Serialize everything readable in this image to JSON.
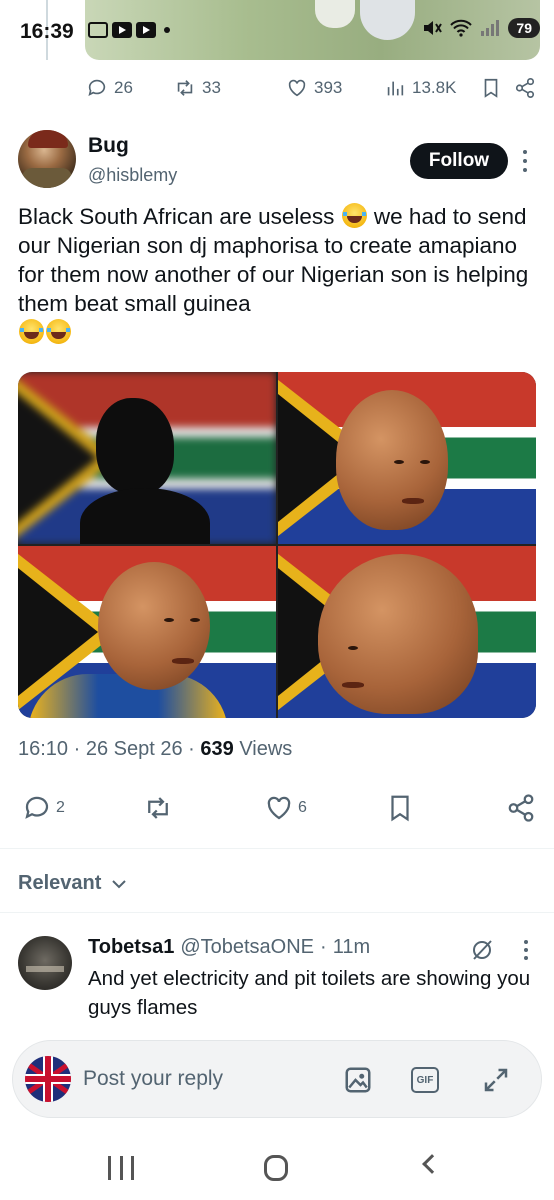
{
  "status_bar": {
    "time": "16:39",
    "battery": "79",
    "icons": [
      "screenshot-icon",
      "youtube-icon",
      "youtube-icon",
      "notification-dot",
      "mute-icon",
      "wifi-icon",
      "signal-icon",
      "battery-icon"
    ]
  },
  "top_actions": {
    "replies": "26",
    "reposts": "33",
    "likes": "393",
    "views": "13.8K"
  },
  "tweet": {
    "author_name": "Bug",
    "author_handle": "@hisblemy",
    "follow_label": "Follow",
    "text_part1": "Black South African are useless ",
    "text_part2": " we had to send our Nigerian son dj maphorisa to create amapiano for them now another of our Nigerian son is helping them beat small guinea ",
    "time": "16:10",
    "date": "26 Sept 26",
    "views_count": "639",
    "views_label": "Views",
    "media_description_icons": [
      "silhouette",
      "face-1",
      "face-2",
      "face-3"
    ]
  },
  "actions": {
    "replies": "2",
    "reposts": "",
    "likes": "6"
  },
  "relevant_label": "Relevant",
  "reply": {
    "name": "Tobetsa1",
    "handle": "@TobetsaONE",
    "dot": "·",
    "time": "11m",
    "text": "And yet electricity and pit toilets are showing you guys flames"
  },
  "composer": {
    "placeholder": "Post your reply",
    "gif_label": "GIF"
  },
  "colors": {
    "text_primary": "#0f1419",
    "text_secondary": "#536471",
    "follow_bg": "#0f1419"
  }
}
